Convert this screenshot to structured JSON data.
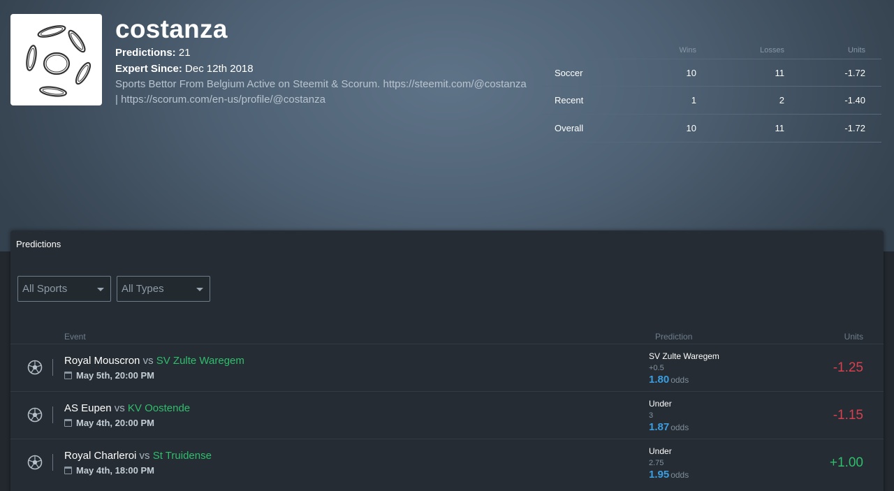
{
  "profile": {
    "username": "costanza",
    "predictions_label": "Predictions:",
    "predictions_value": "21",
    "expert_since_label": "Expert Since:",
    "expert_since_value": "Dec 12th 2018",
    "bio": "Sports Bettor From Belgium Active on Steemit & Scorum. https://steemit.com/@costanza | https://scorum.com/en-us/profile/@costanza"
  },
  "stats": {
    "headers": [
      "Wins",
      "Losses",
      "Units"
    ],
    "rows": [
      {
        "label": "Soccer",
        "wins": "10",
        "losses": "11",
        "units": "-1.72"
      },
      {
        "label": "Recent",
        "wins": "1",
        "losses": "2",
        "units": "-1.40"
      },
      {
        "label": "Overall",
        "wins": "10",
        "losses": "11",
        "units": "-1.72"
      }
    ]
  },
  "panel": {
    "title": "Predictions",
    "filters": {
      "sports": "All Sports",
      "types": "All Types"
    },
    "columns": {
      "event": "Event",
      "prediction": "Prediction",
      "units": "Units"
    }
  },
  "predictions": [
    {
      "home": "Royal Mouscron",
      "vs": "vs",
      "away": "SV Zulte Waregem",
      "date": "May 5th, 20:00 PM",
      "pick": "SV Zulte Waregem",
      "line": "+0.5",
      "odds": "1.80",
      "odds_label": "odds",
      "units": "-1.25",
      "result": "loss"
    },
    {
      "home": "AS Eupen",
      "vs": "vs",
      "away": "KV Oostende",
      "date": "May 4th, 20:00 PM",
      "pick": "Under",
      "line": "3",
      "odds": "1.87",
      "odds_label": "odds",
      "units": "-1.15",
      "result": "loss"
    },
    {
      "home": "Royal Charleroi",
      "vs": "vs",
      "away": "St Truidense",
      "date": "May 4th, 18:00 PM",
      "pick": "Under",
      "line": "2.75",
      "odds": "1.95",
      "odds_label": "odds",
      "units": "+1.00",
      "result": "win"
    }
  ],
  "colors": {
    "loss": "#d8404f",
    "win": "#2fbf6c",
    "odds": "#3b9ee0",
    "away_team": "#2fbf6c"
  },
  "icons": {
    "sport": "soccer-ball-icon",
    "date": "calendar-icon",
    "dropdown": "caret-down-icon"
  }
}
